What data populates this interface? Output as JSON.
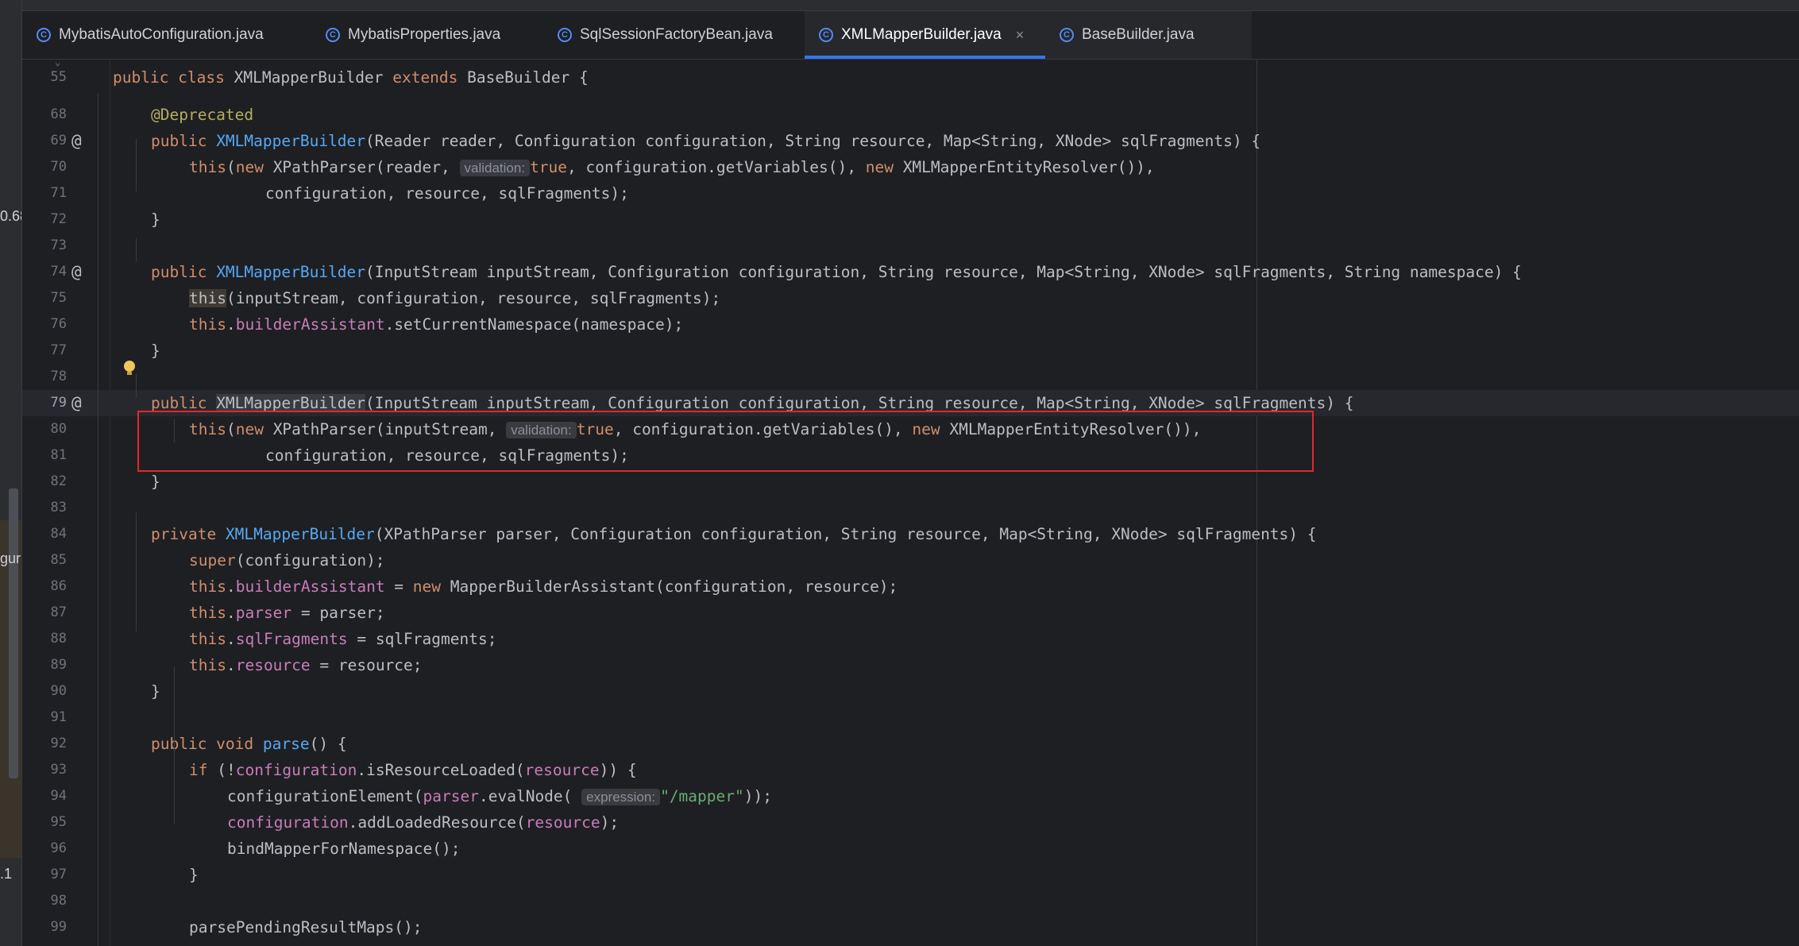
{
  "tabs": [
    {
      "label": "MybatisAutoConfiguration.java",
      "icon": "class-c-icon"
    },
    {
      "label": "MybatisProperties.java",
      "icon": "class-c-icon"
    },
    {
      "label": "SqlSessionFactoryBean.java",
      "icon": "class-c-icon"
    },
    {
      "label": "XMLMapperBuilder.java",
      "icon": "class-c-icon",
      "active": true,
      "close": "×"
    },
    {
      "label": "BaseBuilder.java",
      "icon": "class-c-icon"
    }
  ],
  "side_fragments": {
    "a": "0.68",
    "b": "gur",
    "c": ".1"
  },
  "colors": {
    "keyword": "#cf8e6d",
    "method": "#56a8f5",
    "field": "#c77dbb",
    "annotation": "#b3ae60",
    "string": "#6aab73",
    "tab_underline": "#3574f0",
    "highlight_box": "#e0282e"
  },
  "gutter_marks": {
    "at": "@",
    "fold": "⌄"
  },
  "lines": [
    {
      "n": "55",
      "tokens": [
        [
          "kw",
          "public class "
        ],
        [
          "",
          "XMLMapperBuilder "
        ],
        [
          "kw",
          "extends "
        ],
        [
          "",
          "BaseBuilder {"
        ]
      ]
    },
    {
      "n": "68",
      "tokens": [
        [
          "",
          ""
        ],
        [
          "ann",
          "@Deprecated"
        ]
      ]
    },
    {
      "n": "69",
      "tokens": [
        [
          "kw",
          "public "
        ],
        [
          "fn",
          "XMLMapperBuilder"
        ],
        [
          "",
          "(Reader reader, Configuration configuration, String resource, Map<String, XNode> sqlFragments) {"
        ]
      ]
    },
    {
      "n": "70",
      "tokens": [
        [
          "kw",
          "this"
        ],
        [
          "",
          "("
        ],
        [
          "kw",
          "new "
        ],
        [
          "",
          "XPathParser(reader, "
        ],
        [
          "hint",
          "validation:"
        ],
        [
          "kw",
          "true"
        ],
        [
          "",
          ", configuration.getVariables(), "
        ],
        [
          "kw",
          "new "
        ],
        [
          "",
          "XMLMapperEntityResolver()),"
        ]
      ]
    },
    {
      "n": "71",
      "tokens": [
        [
          "",
          "configuration, resource, sqlFragments);"
        ]
      ]
    },
    {
      "n": "72",
      "tokens": [
        [
          "",
          "}"
        ]
      ]
    },
    {
      "n": "73",
      "tokens": []
    },
    {
      "n": "74",
      "tokens": [
        [
          "kw",
          "public "
        ],
        [
          "fn",
          "XMLMapperBuilder"
        ],
        [
          "",
          "(InputStream inputStream, Configuration configuration, String resource, Map<String, XNode> sqlFragments, String namespace) {"
        ]
      ]
    },
    {
      "n": "75",
      "tokens": [
        [
          "hlthis",
          "this"
        ],
        [
          "",
          "(inputStream, configuration, resource, sqlFragments);"
        ]
      ]
    },
    {
      "n": "76",
      "tokens": [
        [
          "kw",
          "this"
        ],
        [
          "",
          "."
        ],
        [
          "fld",
          "builderAssistant"
        ],
        [
          "",
          ".setCurrentNamespace(namespace);"
        ]
      ]
    },
    {
      "n": "77",
      "tokens": [
        [
          "",
          "}"
        ]
      ]
    },
    {
      "n": "78",
      "tokens": []
    },
    {
      "n": "79",
      "tokens": [
        [
          "kw",
          "public "
        ],
        [
          "hlref",
          "XMLMapperBuilder"
        ],
        [
          "",
          "(InputStream inputStream, Configuration configuration, String resource, Map<String, XNode> sqlFragments) {"
        ]
      ]
    },
    {
      "n": "80",
      "tokens": [
        [
          "kw",
          "this"
        ],
        [
          "",
          "("
        ],
        [
          "kw",
          "new "
        ],
        [
          "",
          "XPathParser(inputStream, "
        ],
        [
          "hint",
          "validation:"
        ],
        [
          "kw",
          "true"
        ],
        [
          "",
          ", configuration.getVariables(), "
        ],
        [
          "kw",
          "new "
        ],
        [
          "",
          "XMLMapperEntityResolver()),"
        ]
      ]
    },
    {
      "n": "81",
      "tokens": [
        [
          "",
          "configuration, resource, sqlFragments);"
        ]
      ]
    },
    {
      "n": "82",
      "tokens": [
        [
          "",
          "}"
        ]
      ]
    },
    {
      "n": "83",
      "tokens": []
    },
    {
      "n": "84",
      "tokens": [
        [
          "kw",
          "private "
        ],
        [
          "fn",
          "XMLMapperBuilder"
        ],
        [
          "",
          "(XPathParser parser, Configuration configuration, String resource, Map<String, XNode> sqlFragments) {"
        ]
      ]
    },
    {
      "n": "85",
      "tokens": [
        [
          "kw",
          "super"
        ],
        [
          "",
          "(configuration);"
        ]
      ]
    },
    {
      "n": "86",
      "tokens": [
        [
          "kw",
          "this"
        ],
        [
          "",
          "."
        ],
        [
          "fld",
          "builderAssistant"
        ],
        [
          "",
          " = "
        ],
        [
          "kw",
          "new "
        ],
        [
          "",
          "MapperBuilderAssistant(configuration, resource);"
        ]
      ]
    },
    {
      "n": "87",
      "tokens": [
        [
          "kw",
          "this"
        ],
        [
          "",
          "."
        ],
        [
          "fld",
          "parser"
        ],
        [
          "",
          " = parser;"
        ]
      ]
    },
    {
      "n": "88",
      "tokens": [
        [
          "kw",
          "this"
        ],
        [
          "",
          "."
        ],
        [
          "fld",
          "sqlFragments"
        ],
        [
          "",
          " = sqlFragments;"
        ]
      ]
    },
    {
      "n": "89",
      "tokens": [
        [
          "kw",
          "this"
        ],
        [
          "",
          "."
        ],
        [
          "fld",
          "resource"
        ],
        [
          "",
          " = resource;"
        ]
      ]
    },
    {
      "n": "90",
      "tokens": [
        [
          "",
          "}"
        ]
      ]
    },
    {
      "n": "91",
      "tokens": []
    },
    {
      "n": "92",
      "tokens": [
        [
          "kw",
          "public void "
        ],
        [
          "fn",
          "parse"
        ],
        [
          "",
          "() {"
        ]
      ]
    },
    {
      "n": "93",
      "tokens": [
        [
          "kw",
          "if "
        ],
        [
          "",
          "(!"
        ],
        [
          "fld",
          "configuration"
        ],
        [
          "",
          ".isResourceLoaded("
        ],
        [
          "fld",
          "resource"
        ],
        [
          "",
          ")) {"
        ]
      ]
    },
    {
      "n": "94",
      "tokens": [
        [
          "",
          "configurationElement("
        ],
        [
          "fld",
          "parser"
        ],
        [
          "",
          ".evalNode( "
        ],
        [
          "hint",
          "expression:"
        ],
        [
          "str",
          "\"/mapper\""
        ],
        [
          "",
          "));"
        ]
      ]
    },
    {
      "n": "95",
      "tokens": [
        [
          "fld",
          "configuration"
        ],
        [
          "",
          ".addLoadedResource("
        ],
        [
          "fld",
          "resource"
        ],
        [
          "",
          ");"
        ]
      ]
    },
    {
      "n": "96",
      "tokens": [
        [
          "",
          "bindMapperForNamespace();"
        ]
      ]
    },
    {
      "n": "97",
      "tokens": [
        [
          "",
          "}"
        ]
      ]
    },
    {
      "n": "98",
      "tokens": []
    },
    {
      "n": "99",
      "tokens": [
        [
          "",
          "parsePendingResultMaps();"
        ]
      ]
    }
  ]
}
